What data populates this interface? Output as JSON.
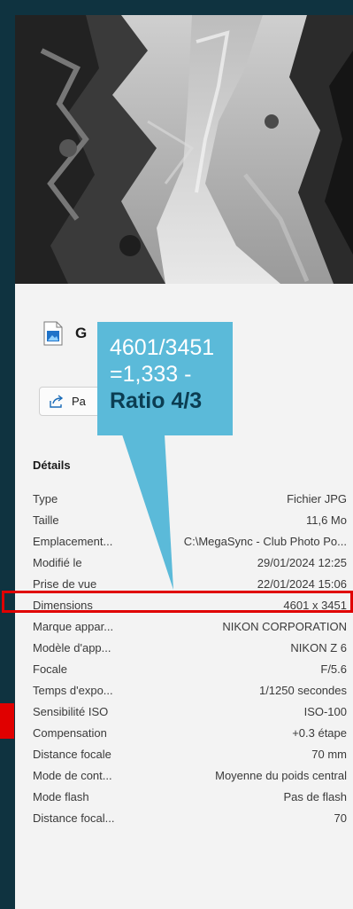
{
  "file": {
    "name_visible": "G",
    "icon": "image-file-icon"
  },
  "share": {
    "label": "Pa",
    "icon": "share-icon"
  },
  "details": {
    "title": "Détails",
    "rows": [
      {
        "k": "Type",
        "v": "Fichier JPG"
      },
      {
        "k": "Taille",
        "v": "11,6 Mo"
      },
      {
        "k": "Emplacement...",
        "v": "C:\\MegaSync - Club Photo Po..."
      },
      {
        "k": "Modifié le",
        "v": "29/01/2024 12:25"
      },
      {
        "k": "Prise de vue",
        "v": "22/01/2024 15:06"
      },
      {
        "k": "Dimensions",
        "v": "4601 x 3451"
      },
      {
        "k": "Marque appar...",
        "v": "NIKON CORPORATION"
      },
      {
        "k": "Modèle d'app...",
        "v": "NIKON Z 6"
      },
      {
        "k": "Focale",
        "v": "F/5.6"
      },
      {
        "k": "Temps d'expo...",
        "v": "1/1250 secondes"
      },
      {
        "k": "Sensibilité ISO",
        "v": "ISO-100"
      },
      {
        "k": "Compensation",
        "v": "+0.3 étape"
      },
      {
        "k": "Distance focale",
        "v": "70 mm"
      },
      {
        "k": "Mode de cont...",
        "v": "Moyenne du poids central"
      },
      {
        "k": "Mode flash",
        "v": "Pas de flash"
      },
      {
        "k": "Distance focal...",
        "v": "70"
      }
    ]
  },
  "callout": {
    "line1": "4601/3451",
    "line2": "=1,333 -",
    "line3": "Ratio 4/3"
  },
  "colors": {
    "background": "#0f3340",
    "panel": "#f3f3f3",
    "callout": "#5bbad9",
    "highlight": "#e00000"
  }
}
